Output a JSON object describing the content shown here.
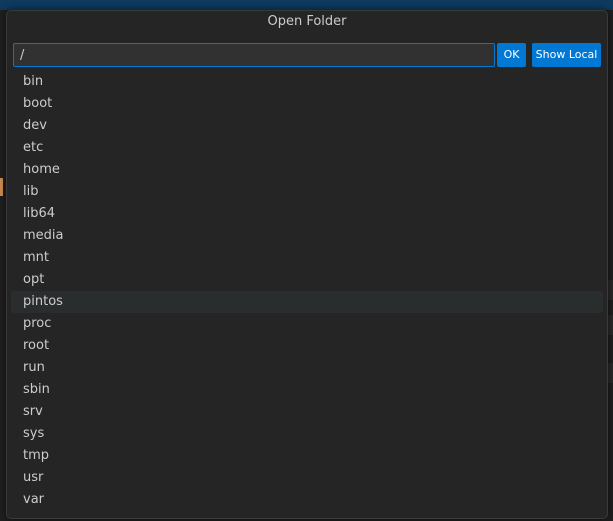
{
  "dialog": {
    "title": "Open Folder",
    "path_input_value": "/",
    "ok_label": "OK",
    "show_local_label": "Show Local"
  },
  "folders": [
    {
      "label": "bin"
    },
    {
      "label": "boot"
    },
    {
      "label": "dev"
    },
    {
      "label": "etc"
    },
    {
      "label": "home"
    },
    {
      "label": "lib"
    },
    {
      "label": "lib64"
    },
    {
      "label": "media"
    },
    {
      "label": "mnt"
    },
    {
      "label": "opt"
    },
    {
      "label": "pintos",
      "hovered": true
    },
    {
      "label": "proc"
    },
    {
      "label": "root"
    },
    {
      "label": "run"
    },
    {
      "label": "sbin"
    },
    {
      "label": "srv"
    },
    {
      "label": "sys"
    },
    {
      "label": "tmp"
    },
    {
      "label": "usr"
    },
    {
      "label": "var"
    }
  ],
  "colors": {
    "accent": "#0078d4",
    "dialog_background": "#252526",
    "hover_background": "#2a2d2e"
  }
}
